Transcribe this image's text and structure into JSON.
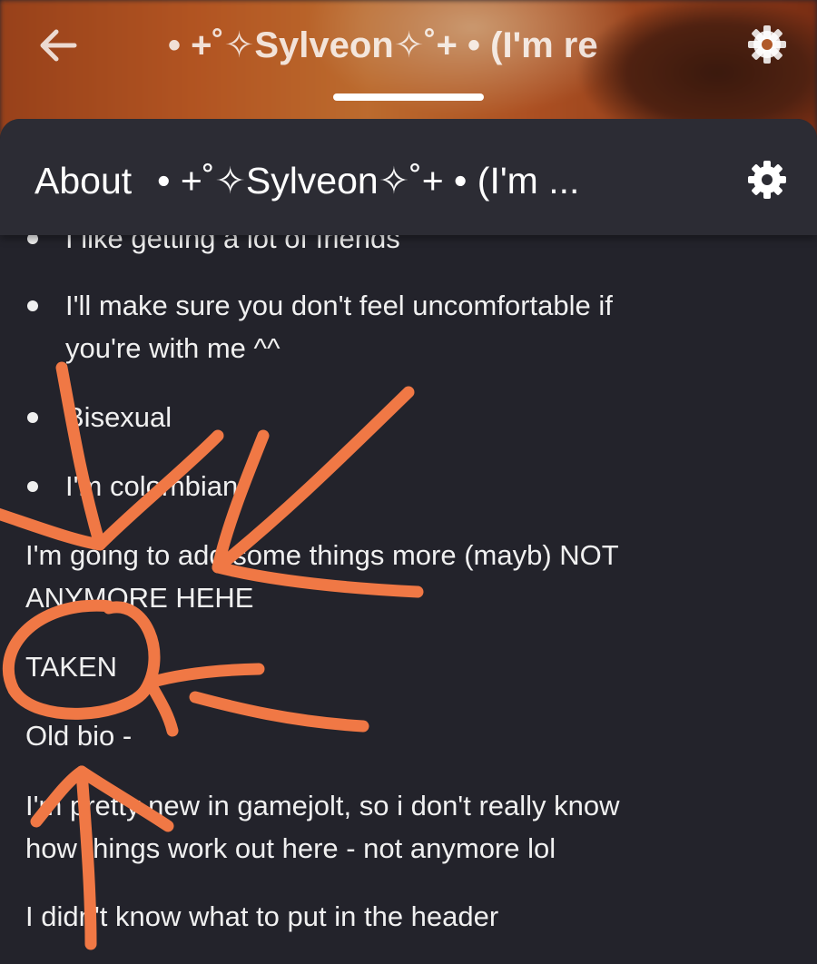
{
  "topbar": {
    "title": "• +˚✧Sylveon✧˚+ • (I'm re"
  },
  "sheet": {
    "header_title": "About",
    "header_subtitle": "• +˚✧Sylveon✧˚+ • (I'm ..."
  },
  "bio": {
    "bullets": [
      "I like getting a lot of friends",
      "I'll make sure you don't feel uncomfortable if",
      "you're with me ^^",
      "Bisexual",
      "I'm colombian"
    ],
    "paragraphs": [
      "I'm going to add some things more (mayb) NOT",
      "ANYMORE HEHE",
      "TAKEN",
      "Old bio -",
      "I'm pretty new in gamejolt, so i don't really know",
      "how things work out here - not anymore lol",
      "I didn't know what to put in the header"
    ]
  },
  "colors": {
    "sheet_background": "#23232b",
    "header_background": "#2c2c34",
    "annotation_orange": "#f07845"
  },
  "icons": [
    "back-arrow-icon",
    "gear-icon"
  ]
}
